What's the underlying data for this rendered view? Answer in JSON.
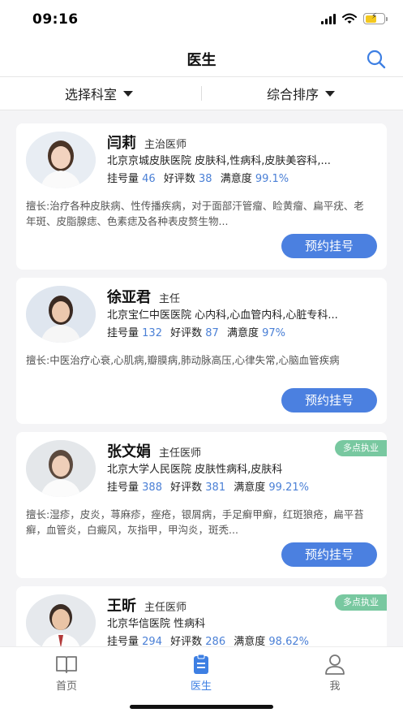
{
  "status_bar": {
    "time": "09:16"
  },
  "nav": {
    "title": "医生"
  },
  "filters": {
    "department": "选择科室",
    "sort": "综合排序"
  },
  "labels": {
    "register_count": "挂号量",
    "reviews": "好评数",
    "satisfaction": "满意度",
    "book_button": "预约挂号"
  },
  "doctors": [
    {
      "name": "闫莉",
      "title": "主治医师",
      "hospital": "北京京城皮肤医院  皮肤科,性病科,皮肤美容科,...",
      "register_count": "46",
      "reviews": "38",
      "satisfaction": "99.1%",
      "specialty": "擅长:治疗各种皮肤病、性传播疾病，对于面部汗管瘤、睑黄瘤、扁平疣、老年斑、皮脂腺痣、色素痣及各种表皮赘生物..."
    },
    {
      "name": "徐亚君",
      "title": "主任",
      "hospital": "北京宝仁中医医院  心内科,心血管内科,心脏专科...",
      "register_count": "132",
      "reviews": "87",
      "satisfaction": "97%",
      "specialty": "擅长:中医治疗心衰,心肌病,瓣膜病,肺动脉高压,心律失常,心脑血管疾病"
    },
    {
      "name": "张文娟",
      "title": "主任医师",
      "badge": "多点执业",
      "hospital": "北京大学人民医院  皮肤性病科,皮肤科",
      "register_count": "388",
      "reviews": "381",
      "satisfaction": "99.21%",
      "specialty": "擅长:湿疹，皮炎，荨麻疹，痤疮，银屑病，手足癣甲癣，红斑狼疮，扁平苔癣，血管炎，白癜风，灰指甲，甲沟炎，斑秃..."
    },
    {
      "name": "王昕",
      "title": "主任医师",
      "badge": "多点执业",
      "hospital": "北京华信医院  性病科",
      "register_count": "294",
      "reviews": "286",
      "satisfaction": "98.62%"
    }
  ],
  "tabbar": {
    "home": "首页",
    "doctor": "医生",
    "me": "我"
  },
  "colors": {
    "accent": "#4b80e0",
    "badge": "#78c8a0",
    "stat_number": "#4b80d6"
  }
}
